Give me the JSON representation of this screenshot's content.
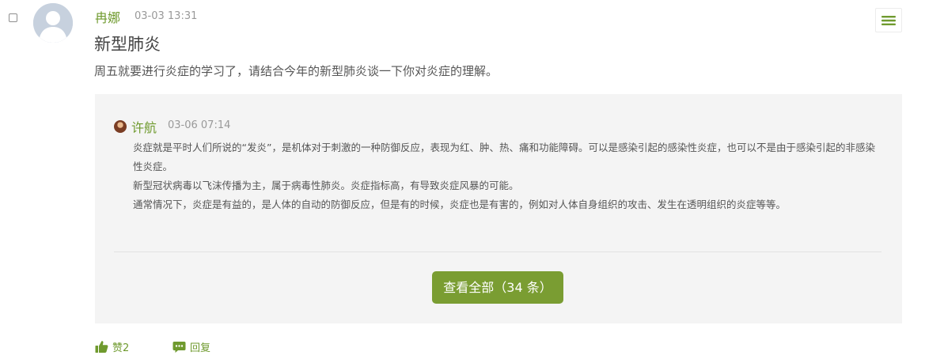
{
  "post": {
    "author": "冉娜",
    "time": "03-03 13:31",
    "title": "新型肺炎",
    "body": "周五就要进行炎症的学习了，请结合今年的新型肺炎谈一下你对炎症的理解。"
  },
  "reply": {
    "author": "许航",
    "time": "03-06 07:14",
    "paragraphs": [
      "炎症就是平时人们所说的“发炎”，是机体对于刺激的一种防御反应，表现为红、肿、热、痛和功能障碍。可以是感染引起的感染性炎症，也可以不是由于感染引起的非感染性炎症。",
      "新型冠状病毒以飞沫传播为主，属于病毒性肺炎。炎症指标高，有导致炎症风暴的可能。",
      "通常情况下，炎症是有益的，是人体的自动的防御反应，但是有的时候，炎症也是有害的，例如对人体自身组织的攻击、发生在透明组织的炎症等等。"
    ]
  },
  "view_all_button": "查看全部（34 条）",
  "actions": {
    "like_label": "赞2",
    "reply_label": "回复"
  },
  "colors": {
    "accent": "#6f9a2e",
    "button": "#7a9d32",
    "panel": "#f4f4f4"
  },
  "icons": {
    "menu": "hamburger-icon",
    "like": "thumbs-up-icon",
    "reply": "comment-icon"
  }
}
